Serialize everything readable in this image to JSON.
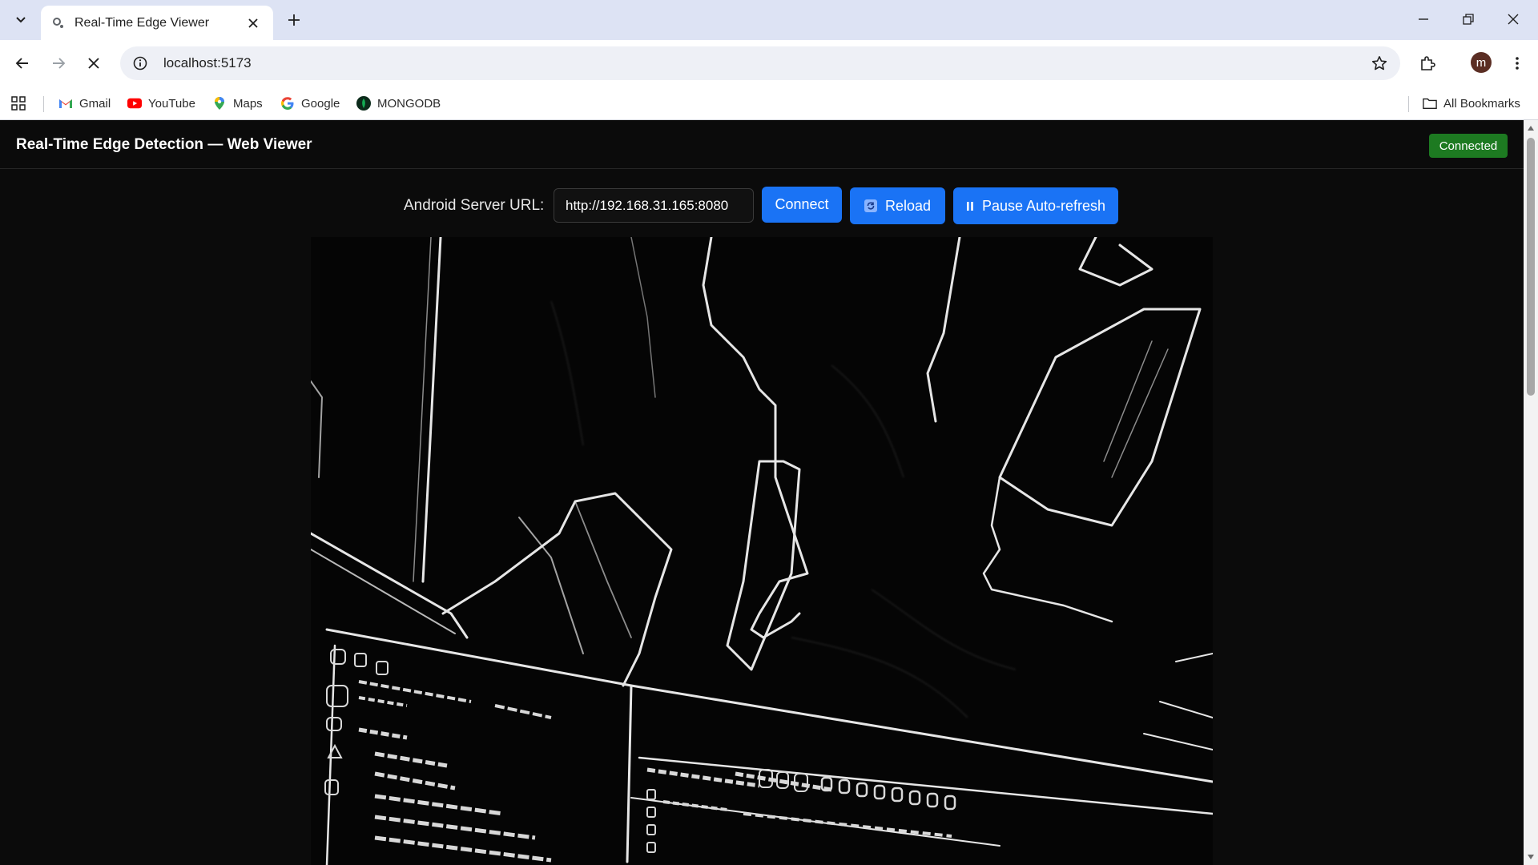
{
  "browser": {
    "tab_title": "Real-Time Edge Viewer",
    "url": "localhost:5173",
    "bookmarks": [
      {
        "label": "Gmail",
        "icon": "gmail-icon"
      },
      {
        "label": "YouTube",
        "icon": "youtube-icon"
      },
      {
        "label": "Maps",
        "icon": "maps-icon"
      },
      {
        "label": "Google",
        "icon": "google-icon"
      },
      {
        "label": "MONGODB",
        "icon": "mongodb-icon"
      }
    ],
    "all_bookmarks_label": "All Bookmarks",
    "profile_initial": "m"
  },
  "app": {
    "title": "Real-Time Edge Detection — Web Viewer",
    "status": "Connected",
    "status_color": "#1d7a21",
    "server_label": "Android Server URL:",
    "server_url": "http://192.168.31.165:8080",
    "connect_label": "Connect",
    "reload_label": "Reload",
    "pause_label": "Pause Auto-refresh",
    "accent_color": "#1a73f5"
  }
}
